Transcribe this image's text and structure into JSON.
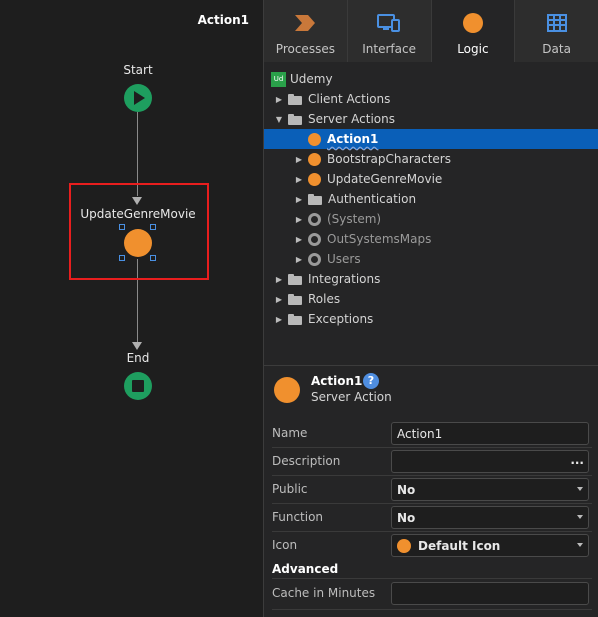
{
  "canvas": {
    "title": "Action1",
    "start_label": "Start",
    "action_label": "UpdateGenreMovie",
    "end_label": "End"
  },
  "tabs": [
    {
      "label": "Processes",
      "icon": "processes-icon",
      "color": "#c9783a"
    },
    {
      "label": "Interface",
      "icon": "interface-icon",
      "color": "#4a90e2"
    },
    {
      "label": "Logic",
      "icon": "logic-icon",
      "color": "#f0902e",
      "active": true
    },
    {
      "label": "Data",
      "icon": "data-icon",
      "color": "#4a90e2"
    }
  ],
  "tree": {
    "root": {
      "badge": "Ud",
      "label": "Udemy"
    },
    "items": [
      {
        "label": "Client Actions"
      },
      {
        "label": "Server Actions"
      },
      {
        "label": "Action1"
      },
      {
        "label": "BootstrapCharacters"
      },
      {
        "label": "UpdateGenreMovie"
      },
      {
        "label": "Authentication"
      },
      {
        "label": "(System)"
      },
      {
        "label": "OutSystemsMaps"
      },
      {
        "label": "Users"
      },
      {
        "label": "Integrations"
      },
      {
        "label": "Roles"
      },
      {
        "label": "Exceptions"
      }
    ]
  },
  "properties": {
    "name": "Action1",
    "type": "Server Action",
    "help": "?",
    "rows": [
      {
        "label": "Name",
        "value": "Action1"
      },
      {
        "label": "Description",
        "value": "",
        "button": "..."
      },
      {
        "label": "Public",
        "value": "No"
      },
      {
        "label": "Function",
        "value": "No"
      },
      {
        "label": "Icon",
        "value": "Default Icon"
      }
    ],
    "advanced_label": "Advanced",
    "cache_label": "Cache in Minutes",
    "cache_value": ""
  },
  "colors": {
    "accent": "#0a5fb8",
    "action": "#f0902e",
    "start_end": "#1e9e5f",
    "highlight": "#e81e1e"
  }
}
